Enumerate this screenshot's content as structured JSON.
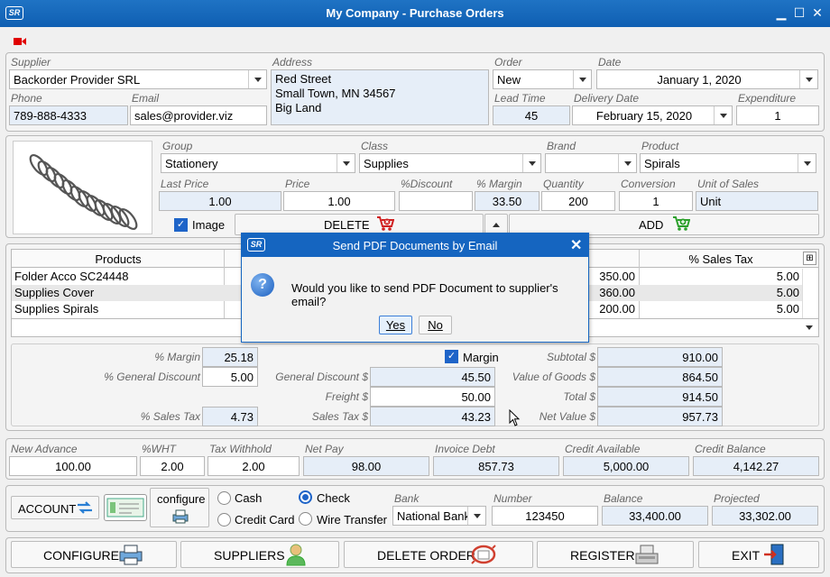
{
  "window": {
    "logo": "SR",
    "title": "My Company - Purchase Orders",
    "minimize": "▁",
    "maximize": "☐",
    "close": "✕"
  },
  "supplier": {
    "supplier_label": "Supplier",
    "supplier_value": "Backorder Provider SRL",
    "address_label": "Address",
    "address_line1": "Red Street",
    "address_line2": "Small Town, MN 34567",
    "address_line3": "Big Land",
    "order_label": "Order",
    "order_value": "New",
    "date_label": "Date",
    "date_value": "January 1, 2020",
    "phone_label": "Phone",
    "phone_value": "789-888-4333",
    "email_label": "Email",
    "email_value": "sales@provider.viz",
    "lead_time_label": "Lead Time",
    "lead_time_value": "45",
    "delivery_label": "Delivery Date",
    "delivery_value": "February 15, 2020",
    "expenditure_label": "Expenditure",
    "expenditure_value": "1"
  },
  "product": {
    "group_label": "Group",
    "group_value": "Stationery",
    "class_label": "Class",
    "class_value": "Supplies",
    "brand_label": "Brand",
    "brand_value": "",
    "product_label": "Product",
    "product_value": "Spirals",
    "last_price_label": "Last Price",
    "last_price_value": "1.00",
    "price_label": "Price",
    "price_value": "1.00",
    "discount_label": "%Discount",
    "discount_value": "",
    "margin_label": "% Margin",
    "margin_value": "33.50",
    "quantity_label": "Quantity",
    "quantity_value": "200",
    "conversion_label": "Conversion",
    "conversion_value": "1",
    "unit_label": "Unit of Sales",
    "unit_value": "Unit",
    "image_check_label": "Image",
    "delete_label": "DELETE",
    "add_label": "ADD"
  },
  "grid": {
    "headers": {
      "products": "Products",
      "sales_tax": "% Sales Tax"
    },
    "rows": [
      {
        "product": "Folder Acco SC24448",
        "amount": "350.00",
        "tax": "5.00"
      },
      {
        "product": "Supplies Cover",
        "amount": "360.00",
        "tax": "5.00"
      },
      {
        "product": "Supplies Spirals",
        "amount": "200.00",
        "tax": "5.00"
      }
    ]
  },
  "totals": {
    "margin_pct_label": "% Margin",
    "margin_pct_value": "25.18",
    "gen_disc_pct_label": "% General Discount",
    "gen_disc_pct_value": "5.00",
    "sales_tax_pct_label": "% Sales Tax",
    "sales_tax_pct_value": "4.73",
    "margin_check_label": "Margin",
    "gen_disc_label": "General Discount $",
    "gen_disc_value": "45.50",
    "freight_label": "Freight $",
    "freight_value": "50.00",
    "sales_tax_label": "Sales Tax $",
    "sales_tax_value": "43.23",
    "subtotal_label": "Subtotal $",
    "subtotal_value": "910.00",
    "goods_label": "Value of Goods $",
    "goods_value": "864.50",
    "total_label": "Total $",
    "total_value": "914.50",
    "net_label": "Net Value $",
    "net_value": "957.73"
  },
  "payment": {
    "new_advance_label": "New Advance",
    "new_advance_value": "100.00",
    "wht_label": "%WHT",
    "wht_value": "2.00",
    "tax_withhold_label": "Tax Withhold",
    "tax_withhold_value": "2.00",
    "net_pay_label": "Net Pay",
    "net_pay_value": "98.00",
    "invoice_debt_label": "Invoice Debt",
    "invoice_debt_value": "857.73",
    "credit_available_label": "Credit Available",
    "credit_available_value": "5,000.00",
    "credit_balance_label": "Credit Balance",
    "credit_balance_value": "4,142.27"
  },
  "account": {
    "account_label": "ACCOUNT",
    "configure_label": "configure",
    "cash_label": "Cash",
    "check_label": "Check",
    "card_label": "Credit Card",
    "wire_label": "Wire Transfer",
    "bank_label": "Bank",
    "bank_value": "National Bank",
    "number_label": "Number",
    "number_value": "123450",
    "balance_label": "Balance",
    "balance_value": "33,400.00",
    "projected_label": "Projected",
    "projected_value": "33,302.00",
    "selected_method": "Check"
  },
  "toolbar": {
    "configure": "CONFIGURE",
    "suppliers": "SUPPLIERS",
    "delete_order": "DELETE ORDER",
    "register": "REGISTER",
    "exit": "EXIT"
  },
  "dialog": {
    "logo": "SR",
    "title": "Send PDF Documents by Email",
    "close": "✕",
    "icon": "?",
    "message": "Would you like to send PDF Document to supplier's email?",
    "yes": "Yes",
    "no": "No"
  },
  "colors": {
    "titlebar": "#1565c0",
    "readonly_field": "#e6eef8",
    "accent": "#1e64c8",
    "record_icon": "#e00000"
  }
}
